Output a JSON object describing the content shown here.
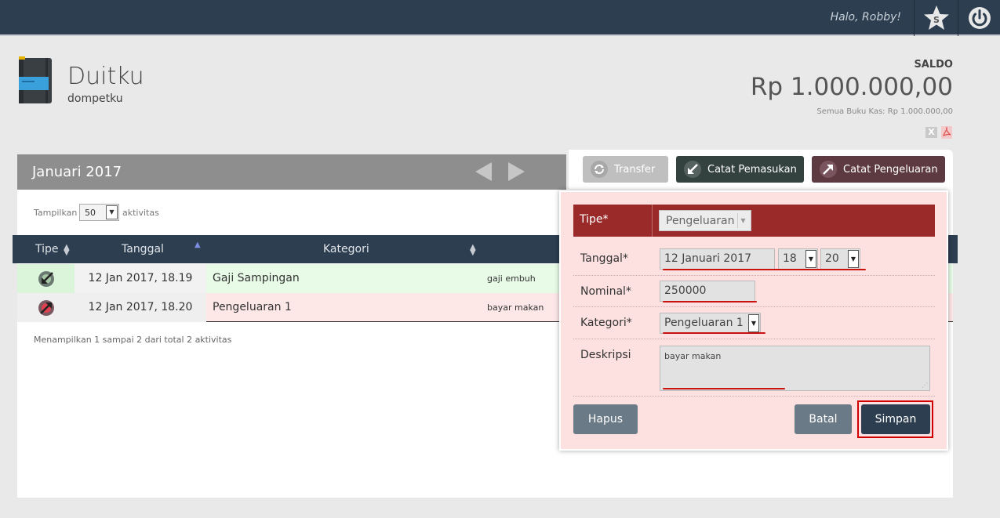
{
  "topbar": {
    "greeting": "Halo, Robby!",
    "star_icon": "star-s-icon",
    "power_icon": "power-icon",
    "accent": "#2c3e50"
  },
  "header": {
    "title": "Duitku",
    "subtitle": "dompetku",
    "book_icon": "wallet-book-icon",
    "saldo_label": "SALDO",
    "saldo_value": "Rp 1.000.000,00",
    "saldo_all": "Semua Buku Kas: Rp 1.000.000,00",
    "export_excel_label": "X",
    "export_pdf_icon": "pdf-icon"
  },
  "period": {
    "title": "Januari 2017",
    "prev_icon": "arrow-left-icon",
    "next_icon": "arrow-right-icon"
  },
  "actions": {
    "transfer": "Transfer",
    "income": "Catat Pemasukan",
    "expense": "Catat Pengeluaran"
  },
  "list": {
    "show_label": "Tampilkan",
    "show_value": "50",
    "show_after": "aktivitas",
    "columns": [
      "Tipe",
      "Tanggal",
      "Kategori"
    ],
    "rows": [
      {
        "type": "income",
        "date": "12 Jan 2017, 18.19",
        "category": "Gaji Sampingan",
        "description": "gaji embuh"
      },
      {
        "type": "expense",
        "date": "12 Jan 2017, 18.20",
        "category": "Pengeluaran 1",
        "description": "bayar makan"
      }
    ],
    "footer": "Menampilkan 1 sampai 2 dari total 2 aktivitas"
  },
  "dialog": {
    "type_label": "Tipe*",
    "type_value": "Pengeluaran",
    "date_label": "Tanggal*",
    "date_value": "12 Januari 2017",
    "hour_value": "18",
    "minute_value": "20",
    "amount_label": "Nominal*",
    "amount_value": "250000",
    "category_label": "Kategori*",
    "category_value": "Pengeluaran 1",
    "desc_label": "Deskripsi",
    "desc_value": "bayar makan",
    "delete_button": "Hapus",
    "cancel_button": "Batal",
    "save_button": "Simpan",
    "colors": {
      "header": "#9a2a2a",
      "background": "#fde0e0",
      "highlight": "#d00000"
    }
  }
}
